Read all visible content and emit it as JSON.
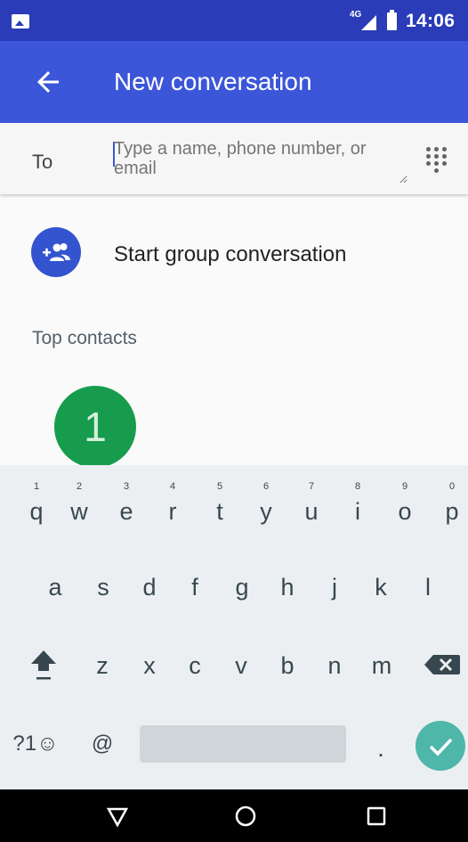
{
  "status_bar": {
    "network": "4G",
    "time": "14:06"
  },
  "app_bar": {
    "title": "New conversation"
  },
  "to_field": {
    "label": "To",
    "placeholder": "Type a name, phone number, or email"
  },
  "group": {
    "label": "Start group conversation",
    "icon": "group-add-icon"
  },
  "top_contacts": {
    "title": "Top contacts",
    "contacts": [
      {
        "initial": "1",
        "color": "#169c4c"
      }
    ]
  },
  "keyboard": {
    "row1": [
      {
        "key": "q",
        "hint": "1"
      },
      {
        "key": "w",
        "hint": "2"
      },
      {
        "key": "e",
        "hint": "3"
      },
      {
        "key": "r",
        "hint": "4"
      },
      {
        "key": "t",
        "hint": "5"
      },
      {
        "key": "y",
        "hint": "6"
      },
      {
        "key": "u",
        "hint": "7"
      },
      {
        "key": "i",
        "hint": "8"
      },
      {
        "key": "o",
        "hint": "9"
      },
      {
        "key": "p",
        "hint": "0"
      }
    ],
    "row2": [
      "a",
      "s",
      "d",
      "f",
      "g",
      "h",
      "j",
      "k",
      "l"
    ],
    "row3": [
      "z",
      "x",
      "c",
      "v",
      "b",
      "n",
      "m"
    ],
    "symbols": "?1☺",
    "at": "@",
    "period": "."
  },
  "colors": {
    "status_bar": "#2a3cb7",
    "app_bar": "#3b56d8",
    "accent": "#3454cf",
    "contact_green": "#169c4c",
    "done_key": "#4fb6aa"
  }
}
